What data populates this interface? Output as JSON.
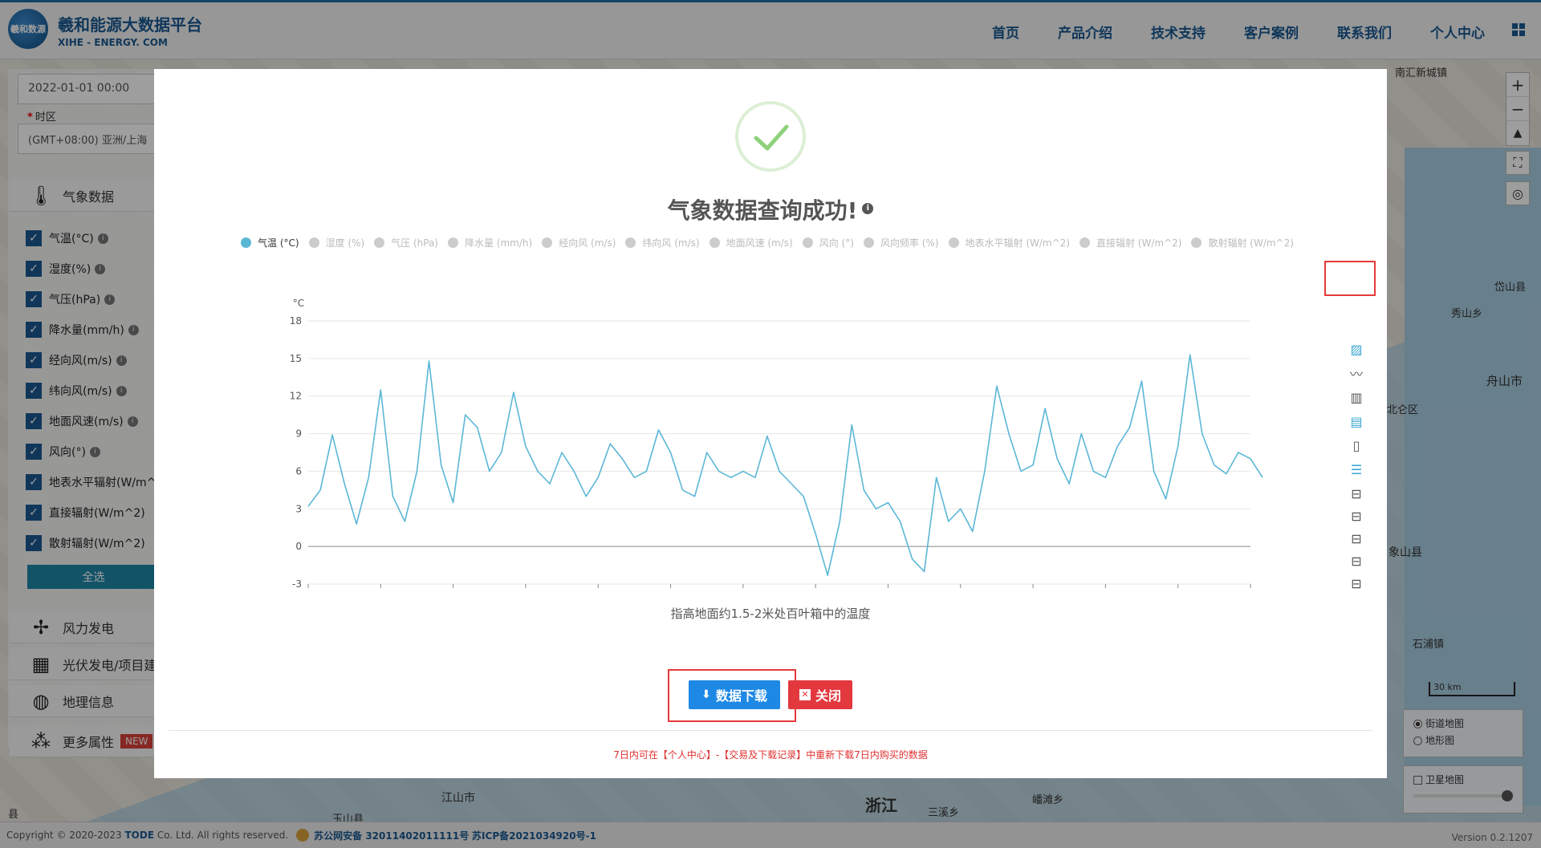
{
  "header": {
    "logo_mark": "羲和数源",
    "title": "羲和能源大数据平台",
    "subtitle": "XIHE - ENERGY. COM",
    "nav": [
      "首页",
      "产品介绍",
      "技术支持",
      "客户案例",
      "联系我们",
      "个人中心"
    ]
  },
  "left_panel": {
    "start_time_value": "2022-01-01 00:00",
    "timezone_label": "时区",
    "timezone_value": "(GMT+08:00) 亚洲/上海",
    "sections": {
      "weather": "气象数据",
      "wind": "风力发电",
      "solar": "光伏发电/项目建",
      "geo": "地理信息",
      "more": "更多属性",
      "new_badge": "NEW"
    },
    "checkboxes": [
      "气温(°C)",
      "湿度(%)",
      "气压(hPa)",
      "降水量(mm/h)",
      "经向风(m/s)",
      "纬向风(m/s)",
      "地面风速(m/s)",
      "风向(°)",
      "地表水平辐射(W/m^",
      "直接辐射(W/m^2)",
      "散射辐射(W/m^2)"
    ],
    "select_all": "全选"
  },
  "map": {
    "labels": {
      "nanhui": "南汇新城镇",
      "daishan": "岱山县",
      "xiushan": "秀山乡",
      "zhoushan": "舟山市",
      "beilun": "北仑区",
      "xiangshan": "象山县",
      "shipu": "石浦镇",
      "jiangshan": "江山市",
      "yushan": "玉山县",
      "zhejiang": "浙江",
      "sanxi": "三溪乡",
      "maotan": "嶓滩乡",
      "xian": "县"
    },
    "scale": "30 km",
    "layers": {
      "street": "街道地图",
      "terrain": "地形图",
      "satellite": "卫星地图"
    }
  },
  "modal": {
    "title": "气象数据查询成功!",
    "legend": [
      "气温 (°C)",
      "湿度 (%)",
      "气压 (hPa)",
      "降水量 (mm/h)",
      "经向风 (m/s)",
      "纬向风 (m/s)",
      "地面风速 (m/s)",
      "风向 (°)",
      "风向频率 (%)",
      "地表水平辐射 (W/m^2)",
      "直接辐射 (W/m^2)",
      "散射辐射 (W/m^2)"
    ],
    "chart_description": "指高地面约1.5-2米处百叶箱中的温度",
    "download_label": "数据下载",
    "close_label": "关闭",
    "note": "7日内可在【个人中心】-【交易及下载记录】中重新下载7日内购买的数据"
  },
  "footer": {
    "copyright_prefix": "Copyright © 2020-2023",
    "company": "TODE",
    "copyright_suffix": "Co. Ltd. All rights reserved.",
    "police": "苏公网安备 32011402011111号",
    "icp": "苏ICP备2021034920号-1",
    "version": "Version 0.2.1207"
  },
  "colors": {
    "brand": "#1a5a92",
    "line": "#5bb7d6",
    "download": "#1e88e5",
    "close": "#e2383e"
  },
  "chart_data": {
    "type": "line",
    "ylabel": "°C",
    "ylim": [
      -3,
      18
    ],
    "yticks": [
      -3,
      0,
      3,
      6,
      9,
      12,
      15,
      18
    ],
    "xticks": [
      "2022-01-01 00:00:00",
      "2022-01-02 12:00:00",
      "2022-01-04 00:00:00",
      "2022-01-05 12:00:00",
      "2022-01-07 00:00:00",
      "2022-01-08 12:00:00",
      "2022-01-10 00:00:00",
      "2022-01-11 12:00:00",
      "2022-01-13 00:00:00",
      "2022-01-14 12:00:00",
      "2022-01-16 00:00:00",
      "2022-01-17 12:00:00",
      "2022-01-19 00:00:00",
      "2022-01-20 12:00:00"
    ],
    "series": [
      {
        "name": "气温 (°C)",
        "points": [
          [
            "2022-01-01 00:00",
            3.2
          ],
          [
            "2022-01-01 06:00",
            4.5
          ],
          [
            "2022-01-01 12:00",
            8.9
          ],
          [
            "2022-01-01 18:00",
            5.0
          ],
          [
            "2022-01-02 00:00",
            1.8
          ],
          [
            "2022-01-02 06:00",
            5.5
          ],
          [
            "2022-01-02 12:00",
            12.5
          ],
          [
            "2022-01-02 18:00",
            4.0
          ],
          [
            "2022-01-03 00:00",
            2.0
          ],
          [
            "2022-01-03 06:00",
            6.0
          ],
          [
            "2022-01-03 12:00",
            14.8
          ],
          [
            "2022-01-03 18:00",
            6.5
          ],
          [
            "2022-01-04 00:00",
            3.5
          ],
          [
            "2022-01-04 06:00",
            10.5
          ],
          [
            "2022-01-04 12:00",
            9.5
          ],
          [
            "2022-01-04 18:00",
            6.0
          ],
          [
            "2022-01-05 00:00",
            7.5
          ],
          [
            "2022-01-05 06:00",
            12.3
          ],
          [
            "2022-01-05 12:00",
            8.0
          ],
          [
            "2022-01-05 18:00",
            6.0
          ],
          [
            "2022-01-06 00:00",
            5.0
          ],
          [
            "2022-01-06 06:00",
            7.5
          ],
          [
            "2022-01-06 12:00",
            6.0
          ],
          [
            "2022-01-06 18:00",
            4.0
          ],
          [
            "2022-01-07 00:00",
            5.5
          ],
          [
            "2022-01-07 06:00",
            8.2
          ],
          [
            "2022-01-07 12:00",
            7.0
          ],
          [
            "2022-01-07 18:00",
            5.5
          ],
          [
            "2022-01-08 00:00",
            6.0
          ],
          [
            "2022-01-08 06:00",
            9.3
          ],
          [
            "2022-01-08 12:00",
            7.5
          ],
          [
            "2022-01-08 18:00",
            4.5
          ],
          [
            "2022-01-09 00:00",
            4.0
          ],
          [
            "2022-01-09 06:00",
            7.5
          ],
          [
            "2022-01-09 12:00",
            6.0
          ],
          [
            "2022-01-09 18:00",
            5.5
          ],
          [
            "2022-01-10 00:00",
            6.0
          ],
          [
            "2022-01-10 06:00",
            5.5
          ],
          [
            "2022-01-10 12:00",
            8.8
          ],
          [
            "2022-01-10 18:00",
            6.0
          ],
          [
            "2022-01-11 00:00",
            5.0
          ],
          [
            "2022-01-11 06:00",
            4.0
          ],
          [
            "2022-01-11 12:00",
            1.0
          ],
          [
            "2022-01-11 18:00",
            -2.3
          ],
          [
            "2022-01-12 00:00",
            2.0
          ],
          [
            "2022-01-12 06:00",
            9.7
          ],
          [
            "2022-01-12 12:00",
            4.5
          ],
          [
            "2022-01-12 18:00",
            3.0
          ],
          [
            "2022-01-13 00:00",
            3.5
          ],
          [
            "2022-01-13 06:00",
            2.0
          ],
          [
            "2022-01-13 12:00",
            -1.0
          ],
          [
            "2022-01-13 18:00",
            -2.0
          ],
          [
            "2022-01-14 00:00",
            5.5
          ],
          [
            "2022-01-14 06:00",
            2.0
          ],
          [
            "2022-01-14 12:00",
            3.0
          ],
          [
            "2022-01-14 18:00",
            1.2
          ],
          [
            "2022-01-15 00:00",
            6.0
          ],
          [
            "2022-01-15 06:00",
            12.8
          ],
          [
            "2022-01-15 12:00",
            9.0
          ],
          [
            "2022-01-15 18:00",
            6.0
          ],
          [
            "2022-01-16 00:00",
            6.5
          ],
          [
            "2022-01-16 06:00",
            11.0
          ],
          [
            "2022-01-16 12:00",
            7.0
          ],
          [
            "2022-01-16 18:00",
            5.0
          ],
          [
            "2022-01-17 00:00",
            9.0
          ],
          [
            "2022-01-17 06:00",
            6.0
          ],
          [
            "2022-01-17 12:00",
            5.5
          ],
          [
            "2022-01-17 18:00",
            8.0
          ],
          [
            "2022-01-18 00:00",
            9.5
          ],
          [
            "2022-01-18 06:00",
            13.2
          ],
          [
            "2022-01-18 12:00",
            6.0
          ],
          [
            "2022-01-18 18:00",
            3.8
          ],
          [
            "2022-01-19 00:00",
            8.0
          ],
          [
            "2022-01-19 06:00",
            15.3
          ],
          [
            "2022-01-19 12:00",
            9.0
          ],
          [
            "2022-01-19 18:00",
            6.5
          ],
          [
            "2022-01-20 00:00",
            5.8
          ],
          [
            "2022-01-20 06:00",
            7.5
          ],
          [
            "2022-01-20 12:00",
            7.0
          ],
          [
            "2022-01-20 18:00",
            5.5
          ]
        ]
      }
    ]
  }
}
